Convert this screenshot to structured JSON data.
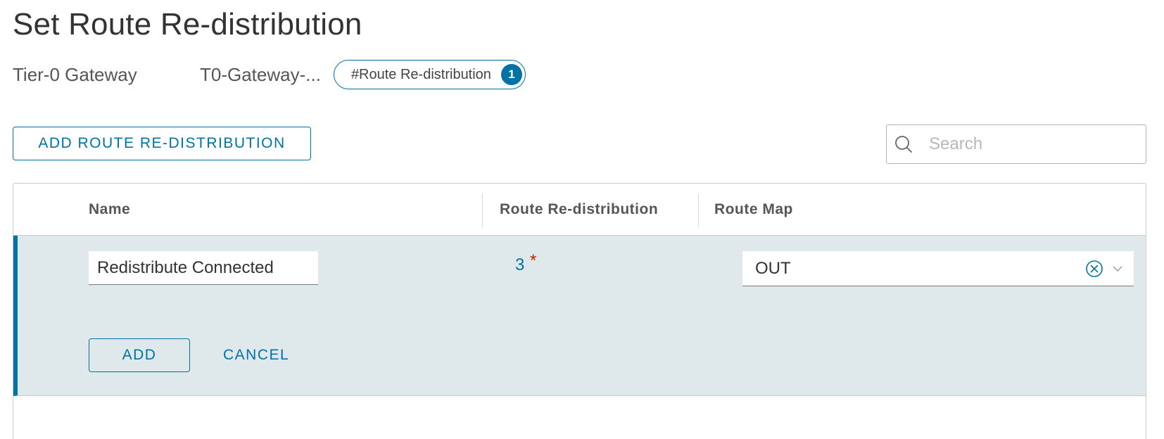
{
  "page": {
    "title": "Set Route Re-distribution"
  },
  "meta": {
    "label": "Tier-0 Gateway",
    "value": "T0-Gateway-...",
    "tag_label": "#Route Re-distribution",
    "tag_count": "1"
  },
  "toolbar": {
    "add_label": "ADD ROUTE RE-DISTRIBUTION",
    "search_placeholder": "Search",
    "search_icon": "search-icon"
  },
  "grid": {
    "columns": [
      "Name",
      "Route Re-distribution",
      "Route Map"
    ],
    "edit_row": {
      "name_value": "Redistribute Connected",
      "redistribution_count": "3",
      "required_marker": "*",
      "route_map_value": "OUT",
      "clear_icon": "close-circle-icon",
      "dropdown_icon": "chevron-down-icon",
      "add_label": "ADD",
      "cancel_label": "CANCEL"
    }
  },
  "colors": {
    "accent": "#0072a3",
    "edit_row_bg": "#dfe9ec",
    "required": "#c92100"
  }
}
